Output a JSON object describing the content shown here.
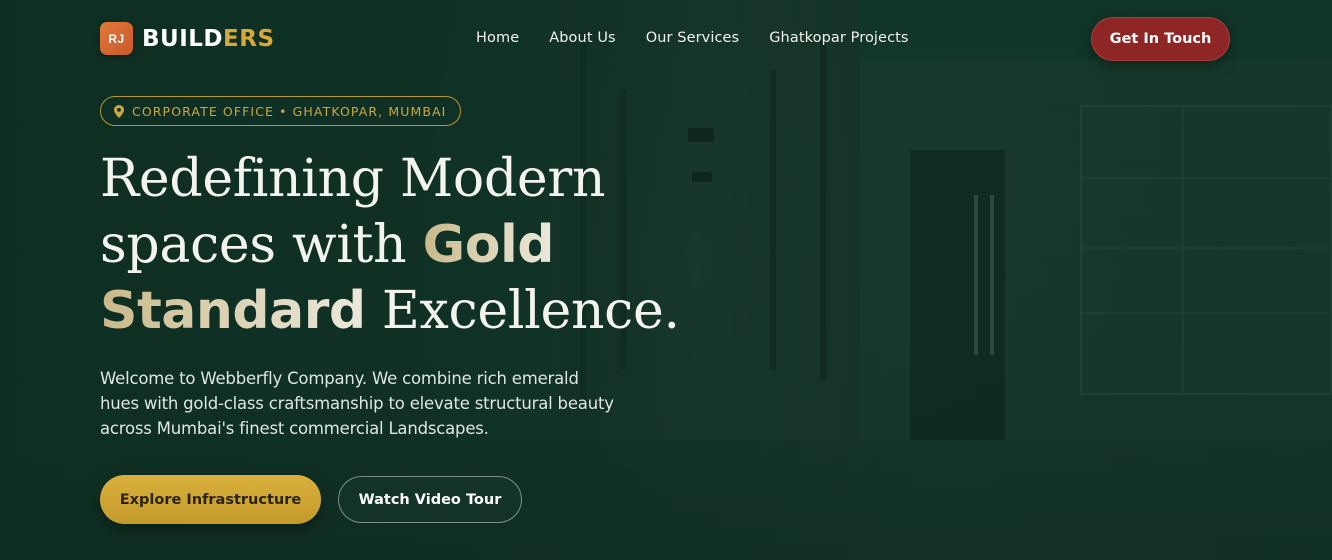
{
  "brand": {
    "mark": "RJ",
    "name_part1": "BUILD",
    "name_part2": "ERS",
    "accent_color": "#d7a93a"
  },
  "nav": {
    "items": [
      {
        "label": "Home"
      },
      {
        "label": "About Us"
      },
      {
        "label": "Our Services"
      },
      {
        "label": "Ghatkopar Projects"
      }
    ],
    "cta_label": "Get In Touch",
    "cta_color": "#8d2624"
  },
  "hero": {
    "badge": {
      "icon": "map-pin-icon",
      "label": "CORPORATE OFFICE • GHATKOPAR, MUMBAI"
    },
    "headline": {
      "line1": "Redefining Modern",
      "line2_a": "spaces with ",
      "line2_gold": "Gold",
      "line3_gold": "Standard",
      "line3_b": " Excellence."
    },
    "description": "Welcome to Webberfly Company. We combine rich emerald hues with gold-class craftsmanship to elevate structural beauty across Mumbai's finest commercial Landscapes.",
    "primary_button": "Explore Infrastructure",
    "secondary_button": "Watch Video Tour",
    "colors": {
      "background": "#123a2c",
      "gold": "#d9b03c"
    }
  }
}
